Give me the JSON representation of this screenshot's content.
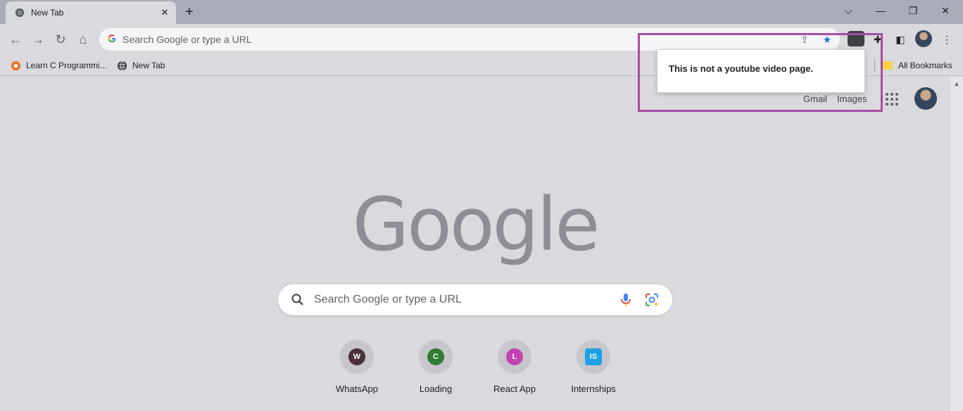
{
  "tab": {
    "title": "New Tab",
    "close_icon": "close-icon",
    "new_tab_icon": "plus-icon"
  },
  "window_controls": [
    "chevron-down-icon",
    "minimize-icon",
    "restore-icon",
    "close-icon"
  ],
  "omnibox": {
    "placeholder": "Search Google or type a URL"
  },
  "bookmarks": {
    "items": [
      {
        "label": "Learn C Programmi..."
      },
      {
        "label": "New Tab"
      }
    ],
    "all_bookmarks": "All Bookmarks"
  },
  "header_links": {
    "gmail": "Gmail",
    "images": "Images"
  },
  "logo": "Google",
  "search": {
    "placeholder": "Search Google or type a URL"
  },
  "shortcuts": [
    {
      "label": "WhatsApp",
      "letter": "W",
      "color": "#4a2f36"
    },
    {
      "label": "Loading",
      "letter": "C",
      "color": "#2f7d32"
    },
    {
      "label": "React App",
      "letter": "L",
      "color": "#c242b0"
    },
    {
      "label": "Internships",
      "letter": "IS",
      "color": "#1da1e6"
    }
  ],
  "popup": {
    "message": "This is not a youtube video page."
  },
  "colors": {
    "highlight": "#a74ca6",
    "star": "#1a73e8",
    "page_bg": "#d9d9de"
  }
}
